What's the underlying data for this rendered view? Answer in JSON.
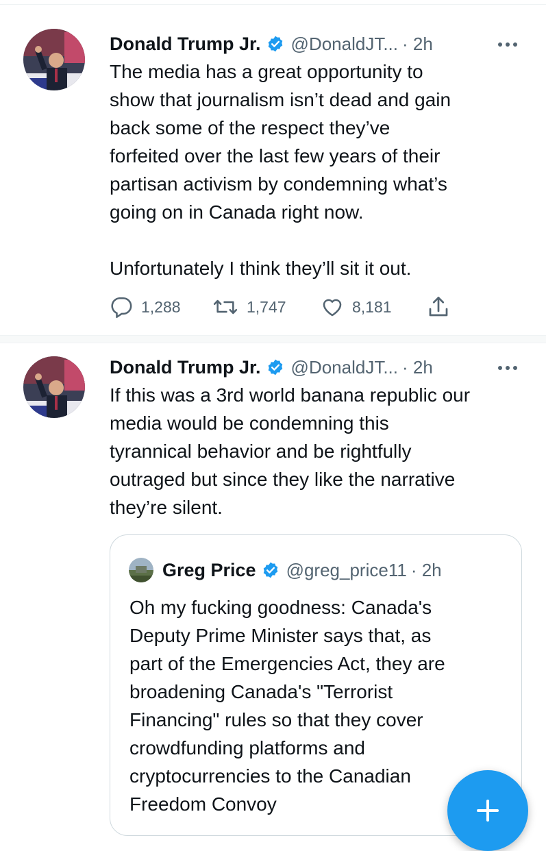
{
  "colors": {
    "accent": "#1d9bf0",
    "text": "#0f1419",
    "secondary": "#536471",
    "border": "#cfd9de"
  },
  "tweets": [
    {
      "name": "Donald Trump Jr.",
      "handle": "@DonaldJT...",
      "time": "· 2h",
      "text": "The media has a great opportunity to\nshow that journalism isn’t dead and gain\nback some of the respect they’ve\nforfeited over the last few years of their\npartisan activism by condemning what’s\ngoing on in Canada right now.\n\nUnfortunately I think they’ll sit it out.",
      "replies": "1,288",
      "retweets": "1,747",
      "likes": "8,181",
      "icons": [
        "reply-icon",
        "retweet-icon",
        "like-icon",
        "share-icon"
      ]
    },
    {
      "name": "Donald Trump Jr.",
      "handle": "@DonaldJT...",
      "time": "· 2h",
      "text": "If this was a 3rd world banana republic our\nmedia would be condemning this\ntyrannical behavior and be rightfully\noutraged but since they like the narrative\nthey’re silent.",
      "quote": {
        "name": "Greg Price",
        "handle": "@greg_price11",
        "time": "· 2h",
        "text": "Oh my fucking goodness: Canada's\nDeputy Prime Minister says that, as\npart of the Emergencies Act, they are\nbroadening Canada's \"Terrorist\nFinancing\" rules so that they cover\ncrowdfunding platforms and\ncryptocurrencies to the Canadian\nFreedom Convoy"
      }
    }
  ],
  "fab_icon": "compose-plus-icon"
}
